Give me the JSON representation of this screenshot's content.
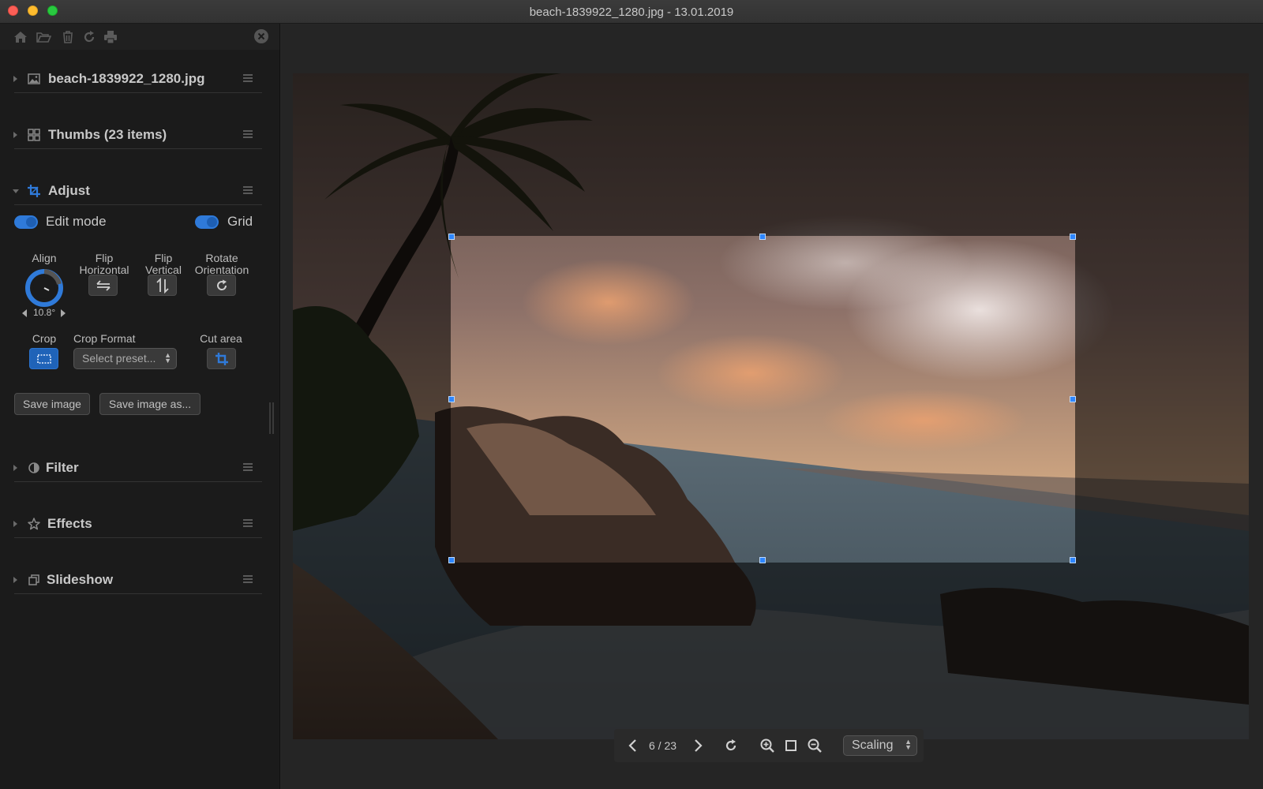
{
  "window": {
    "title": "beach-1839922_1280.jpg - 13.01.2019"
  },
  "toolbar": {
    "icons": [
      "home-icon",
      "folder-open-icon",
      "trash-icon",
      "refresh-icon",
      "print-icon",
      "close-circle-icon"
    ]
  },
  "sections": {
    "file": {
      "label": "beach-1839922_1280.jpg"
    },
    "thumbs": {
      "label": "Thumbs (23 items)"
    },
    "adjust": {
      "label": "Adjust"
    },
    "filter": {
      "label": "Filter"
    },
    "effects": {
      "label": "Effects"
    },
    "slideshow": {
      "label": "Slideshow"
    }
  },
  "adjust": {
    "edit_mode_label": "Edit mode",
    "edit_mode_on": true,
    "grid_label": "Grid",
    "grid_on": true,
    "align_label": "Align",
    "align_value": "10.8°",
    "flip_h_label_1": "Flip",
    "flip_h_label_2": "Horizontal",
    "flip_v_label_1": "Flip",
    "flip_v_label_2": "Vertical",
    "rotate_label_1": "Rotate",
    "rotate_label_2": "Orientation",
    "crop_label": "Crop",
    "crop_format_label": "Crop Format",
    "crop_format_placeholder": "Select preset...",
    "cut_area_label": "Cut area",
    "save_label": "Save image",
    "save_as_label": "Save image as..."
  },
  "viewer": {
    "counter": "6 / 23",
    "scaling_label": "Scaling"
  },
  "colors": {
    "accent": "#2f7ad9",
    "handle": "#2e86ff"
  }
}
